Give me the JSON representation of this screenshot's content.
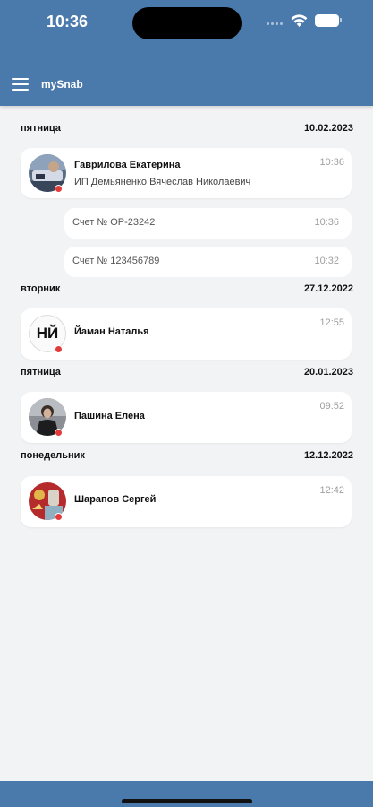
{
  "status_bar": {
    "time": "10:36"
  },
  "app": {
    "title": "mySnab"
  },
  "groups": [
    {
      "day": "пятница",
      "date": "10.02.2023",
      "chats": [
        {
          "name": "Гаврилова Екатерина",
          "subtitle": "ИП Демьяненко Вячеслав Николаевич",
          "time": "10:36",
          "avatar": "photo",
          "unread": true
        }
      ],
      "documents": [
        {
          "label": "Счет № ОР-23242",
          "time": "10:36"
        },
        {
          "label": "Счет № 123456789",
          "time": "10:32"
        }
      ]
    },
    {
      "day": "вторник",
      "date": "27.12.2022",
      "chats": [
        {
          "name": "Йаман Наталья",
          "time": "12:55",
          "avatar": "initials",
          "initials": "НЙ",
          "unread": true
        }
      ]
    },
    {
      "day": "пятница",
      "date": "20.01.2023",
      "chats": [
        {
          "name": "Пашина Елена",
          "time": "09:52",
          "avatar": "photo",
          "unread": true
        }
      ]
    },
    {
      "day": "понедельник",
      "date": "12.12.2022",
      "chats": [
        {
          "name": "Шарапов Сергей",
          "time": "12:42",
          "avatar": "photo",
          "unread": true
        }
      ]
    }
  ],
  "colors": {
    "header": "#4a79ab",
    "unread_dot": "#e23b3b",
    "background": "#f2f3f5"
  }
}
